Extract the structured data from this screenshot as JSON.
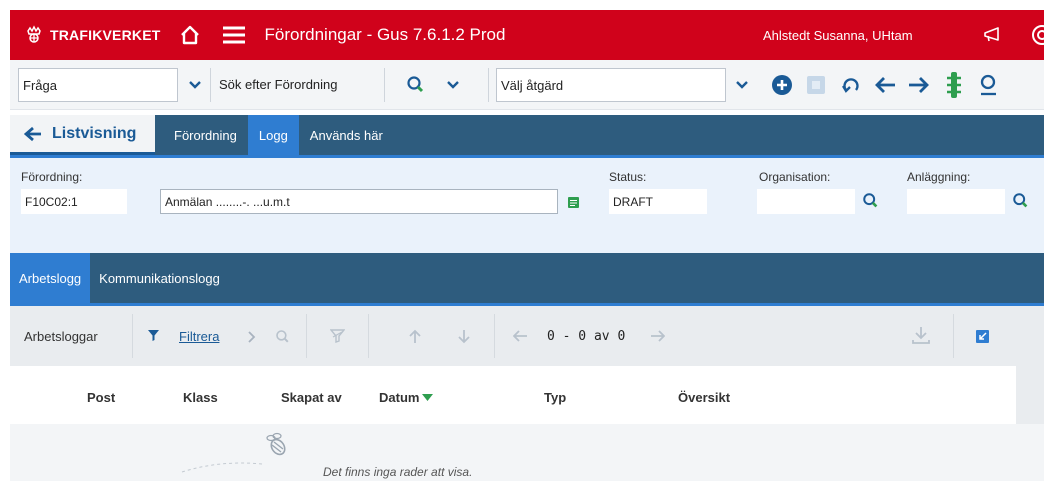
{
  "header": {
    "logo_text": "TRAFIKVERKET",
    "app_title": "Förordningar - Gus 7.6.1.2 Prod",
    "user": "Ahlstedt Susanna, UHtam",
    "bg_color": "#d0021b"
  },
  "toolbar": {
    "query_select": "Fråga",
    "search_label": "Sök efter Förordning",
    "action_select": "Välj åtgärd"
  },
  "nav": {
    "back_label": "Listvisning",
    "tabs": [
      {
        "label": "Förordning"
      },
      {
        "label": "Logg"
      },
      {
        "label": "Används här"
      }
    ],
    "active_tab": "Logg"
  },
  "form": {
    "forordning_label": "Förordning:",
    "forordning_value": "F10C02:1",
    "description_value": "Anmälan ........-. ...u.m.t",
    "status_label": "Status:",
    "status_value": "DRAFT",
    "organisation_label": "Organisation:",
    "organisation_value": "",
    "anlaggning_label": "Anläggning:",
    "anlaggning_value": ""
  },
  "subtabs": {
    "items": [
      {
        "label": "Arbetslogg"
      },
      {
        "label": "Kommunikationslogg"
      }
    ],
    "active": "Arbetslogg"
  },
  "grid": {
    "title": "Arbetsloggar",
    "filter_label": "Filtrera",
    "pager": "0 - 0 av 0",
    "columns": [
      "Post",
      "Klass",
      "Skapat av",
      "Datum",
      "Typ",
      "Översikt"
    ],
    "sorted_column": "Datum",
    "empty_message": "Det finns inga rader att visa."
  },
  "colors": {
    "accent_blue": "#2f7dd1",
    "nav_blue": "#2e5c7e",
    "link_blue": "#1a5a96",
    "green": "#2e9e4f"
  }
}
